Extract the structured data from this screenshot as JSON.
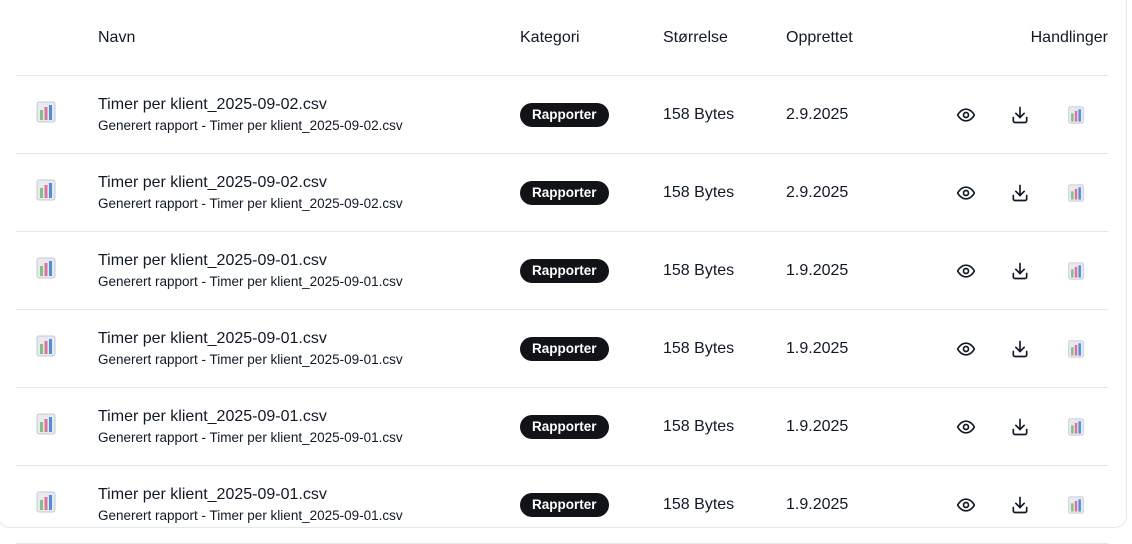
{
  "table": {
    "headers": {
      "name": "Navn",
      "category": "Kategori",
      "size": "Størrelse",
      "created": "Opprettet",
      "actions": "Handlinger"
    },
    "rows": [
      {
        "name": "Timer per klient_2025-09-02.csv",
        "description": "Generert rapport - Timer per klient_2025-09-02.csv",
        "category": "Rapporter",
        "size": "158 Bytes",
        "created": "2.9.2025"
      },
      {
        "name": "Timer per klient_2025-09-02.csv",
        "description": "Generert rapport - Timer per klient_2025-09-02.csv",
        "category": "Rapporter",
        "size": "158 Bytes",
        "created": "2.9.2025"
      },
      {
        "name": "Timer per klient_2025-09-01.csv",
        "description": "Generert rapport - Timer per klient_2025-09-01.csv",
        "category": "Rapporter",
        "size": "158 Bytes",
        "created": "1.9.2025"
      },
      {
        "name": "Timer per klient_2025-09-01.csv",
        "description": "Generert rapport - Timer per klient_2025-09-01.csv",
        "category": "Rapporter",
        "size": "158 Bytes",
        "created": "1.9.2025"
      },
      {
        "name": "Timer per klient_2025-09-01.csv",
        "description": "Generert rapport - Timer per klient_2025-09-01.csv",
        "category": "Rapporter",
        "size": "158 Bytes",
        "created": "1.9.2025"
      },
      {
        "name": "Timer per klient_2025-09-01.csv",
        "description": "Generert rapport - Timer per klient_2025-09-01.csv",
        "category": "Rapporter",
        "size": "158 Bytes",
        "created": "1.9.2025"
      }
    ],
    "icons": {
      "file": "bar-chart-file-icon",
      "view": "eye-icon",
      "download": "download-icon",
      "report": "bar-chart-icon"
    },
    "colors": {
      "badge_bg": "#111318",
      "badge_text": "#ffffff",
      "border": "#e5e7eb"
    }
  }
}
